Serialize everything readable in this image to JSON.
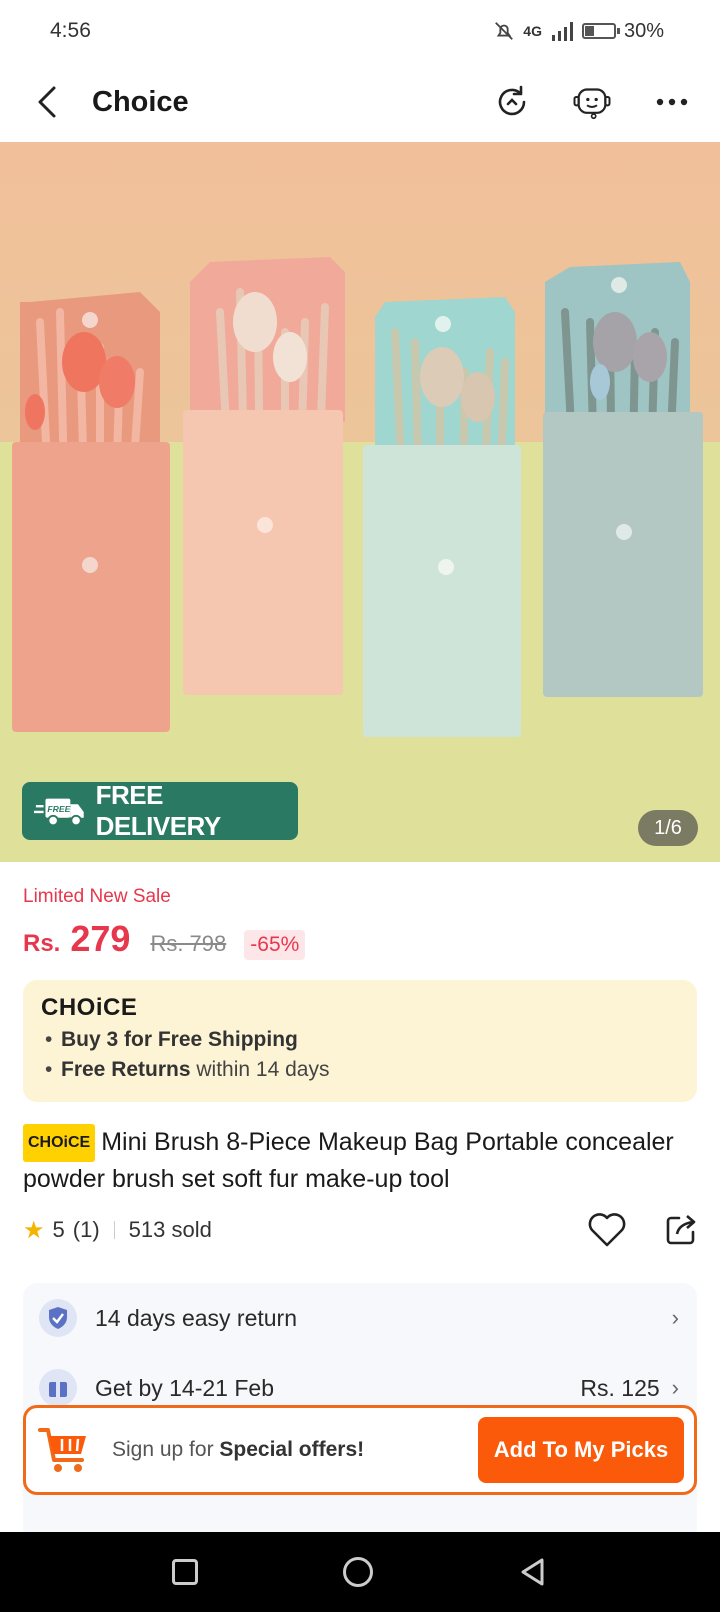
{
  "status_bar": {
    "time": "4:56",
    "network": "4G",
    "battery_percent": "30%",
    "battery_level": 0.3
  },
  "nav": {
    "title": "Choice"
  },
  "hero": {
    "free_delivery": "FREE DELIVERY",
    "free_tag": "FREE",
    "image_counter": "1/6"
  },
  "price": {
    "promo_label": "Limited New Sale",
    "currency": "Rs.",
    "current": "279",
    "original": "Rs. 798",
    "discount": "-65%"
  },
  "choice_box": {
    "logo": "CHOiCE",
    "benefit_1_bold": "Buy 3 for  Free Shipping",
    "benefit_2_bold": "Free Returns",
    "benefit_2_rest": " within 14 days"
  },
  "product": {
    "badge": "CHOiCE",
    "title": "Mini Brush 8-Piece Makeup Bag Portable concealer powder brush set soft fur make-up tool"
  },
  "rating": {
    "score": "5",
    "count": "(1)",
    "sold": "513 sold"
  },
  "info": {
    "return_text": "14 days easy return",
    "delivery_text": "Get by 14-21 Feb",
    "shipping_price": "Rs. 125"
  },
  "picks_bar": {
    "prefix": "Sign up for ",
    "bold": "Special offers!",
    "button": "Add To My Picks"
  },
  "colors": {
    "accent": "#fa5a0a",
    "price": "#e6374d",
    "delivery": "#2a7a63"
  }
}
